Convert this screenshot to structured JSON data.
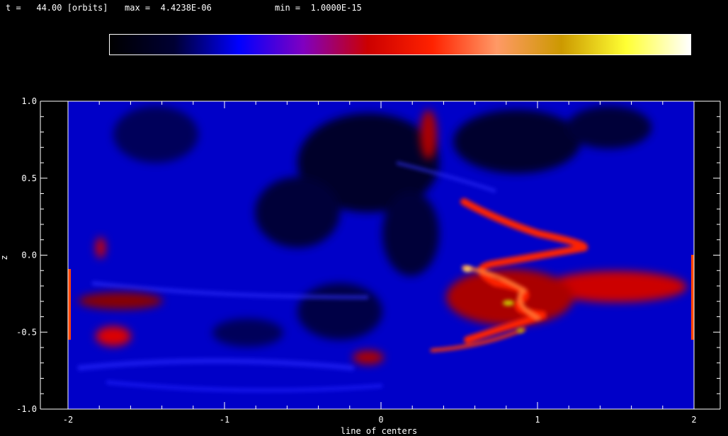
{
  "header": {
    "time_text": "t =   44.00 [orbits]",
    "max_text": "max =  4.4238E-06",
    "min_text": "min =  1.0000E-15"
  },
  "colorbar": {
    "colormap": [
      "#000000",
      "#000033",
      "#0000ff",
      "#8000c0",
      "#cc0000",
      "#ff2200",
      "#ff9966",
      "#cc9900",
      "#ffff33",
      "#ffffff"
    ]
  },
  "chart_data": {
    "type": "heatmap",
    "xlabel": "line of centers",
    "ylabel": "z",
    "xlim": [
      -2,
      2
    ],
    "ylim": [
      -1,
      1
    ],
    "x_ticks": [
      -2,
      -1,
      0,
      1,
      2
    ],
    "x_tick_labels": [
      "-2",
      "-1",
      "0",
      "1",
      "2"
    ],
    "y_ticks": [
      -1.0,
      -0.5,
      0.0,
      0.5,
      1.0
    ],
    "y_tick_labels": [
      "-1.0",
      "-0.5",
      "0.0",
      "0.5",
      "1.0"
    ],
    "color_min": 1e-15,
    "color_max": 4.4238e-06,
    "background": "#0000cc"
  }
}
